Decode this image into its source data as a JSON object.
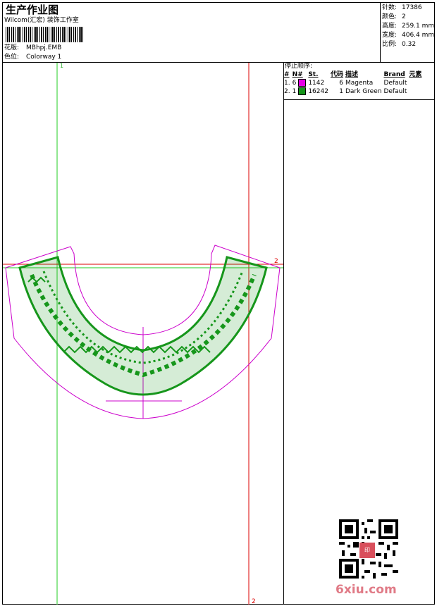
{
  "header": {
    "title": "生产作业图",
    "company": "Wilcom(汇宏) 装饰工作室",
    "design_label": "花版:",
    "design_value": "MBhpj.EMB",
    "colorway_label": "色位:",
    "colorway_value": "Colorway 1"
  },
  "stats": {
    "stitches_label": "针数:",
    "stitches_value": "17386",
    "colors_label": "颜色:",
    "colors_value": "2",
    "height_label": "高度:",
    "height_value": "259.1 mm",
    "width_label": "宽度:",
    "width_value": "406.4 mm",
    "scale_label": "比例:",
    "scale_value": "0.32"
  },
  "stop_sequence": {
    "title": "停止顺序:",
    "headers": [
      "#",
      "N#",
      "St.",
      "代码",
      "描述",
      "Brand",
      "元素"
    ],
    "rows": [
      {
        "num": "1.",
        "needle": "6",
        "color": "#e600e6",
        "stitches": "1142",
        "code": "6",
        "desc": "Magenta",
        "brand": "Default"
      },
      {
        "num": "2.",
        "needle": "1",
        "color": "#16961b",
        "stitches": "16242",
        "code": "1",
        "desc": "Dark Green",
        "brand": "Default"
      }
    ]
  },
  "guides": {
    "v1_label": "1",
    "h2_label": "2",
    "v2_label": "2"
  },
  "watermark": {
    "site": "6xiu.com",
    "seal_text": "印"
  }
}
